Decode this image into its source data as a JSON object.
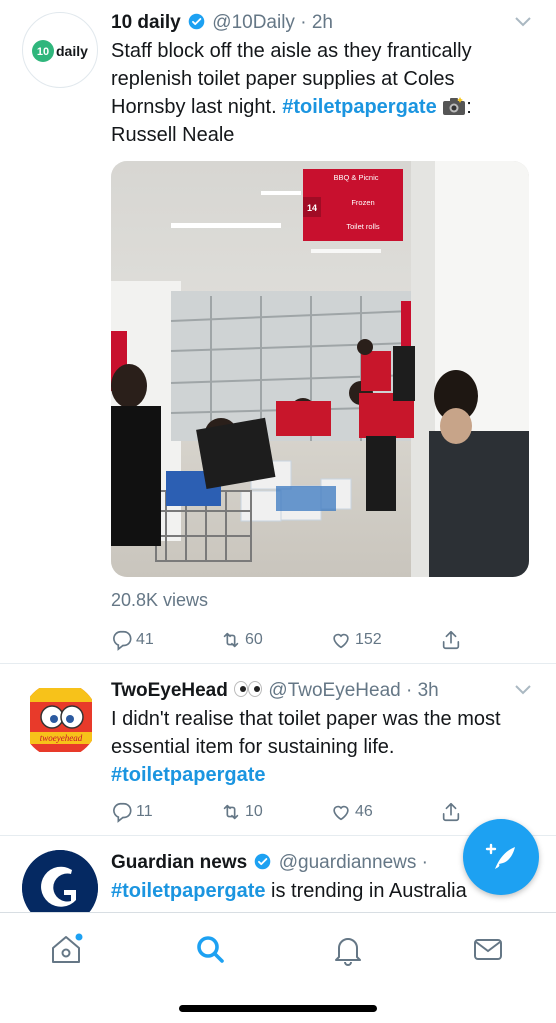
{
  "tweets": [
    {
      "name": "10 daily",
      "handle": "@10Daily",
      "time": "· 2h",
      "text_parts": {
        "pre": "Staff block off the aisle as they frantically replenish toilet paper supplies at Coles Hornsby last night. ",
        "hashtag": "#toiletpapergate",
        "post": ": Russell Neale"
      },
      "avatar_label": "10 daily",
      "views": "20.8K views",
      "replies": "41",
      "retweets": "60",
      "likes": "152",
      "media_signs": [
        "BBQ & Picnic",
        "14",
        "Frozen",
        "Toilet rolls"
      ]
    },
    {
      "name": "TwoEyeHead",
      "handle": "@TwoEyeHead",
      "time": "· 3h",
      "text_parts": {
        "pre": "I didn't realise that toilet paper was the most essential item for sustaining life. ",
        "hashtag": "#toiletpapergate"
      },
      "avatar_label": "twoeyehead",
      "replies": "11",
      "retweets": "10",
      "likes": "46"
    },
    {
      "name": "Guardian news",
      "handle": "@guardiannews ·",
      "text_parts": {
        "hashtag": "#toiletpapergate",
        "post": " is trending in Australia"
      }
    }
  ],
  "tabs": [
    "home-icon",
    "search-icon",
    "notifications-icon",
    "messages-icon"
  ],
  "colors": {
    "accent": "#1da1f2",
    "hashtag": "#1b95e0",
    "muted": "#657786"
  }
}
